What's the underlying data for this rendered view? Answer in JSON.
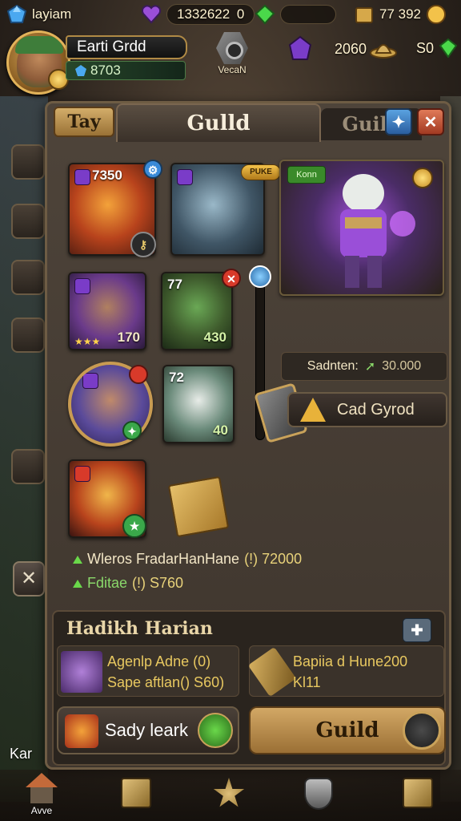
{
  "top_bar": {
    "player_tag": "layiam",
    "premium_currency": "1332622",
    "premium_secondary": "0",
    "gold": "77 392"
  },
  "player": {
    "name": "Earti Grdd",
    "power": "8703"
  },
  "vecan_label": "VecaN",
  "resources_row2": {
    "shards": "2060",
    "tokens": "S0"
  },
  "tabs": {
    "left": "Tay",
    "active": "Gulld",
    "inactive": "Guild"
  },
  "cards": {
    "card1_level": "7350",
    "card2_tag": "PUKE",
    "card3_tag": "Konn",
    "card4_stars": "★★★",
    "card4_value": "170",
    "card5_level": "77",
    "card5_value": "430",
    "card7_level": "72",
    "card7_value": "40"
  },
  "hero_panel": {
    "stat_label": "Sadnten:",
    "stat_value": "30.000",
    "action_label": "Cad Gyrod"
  },
  "info_lines": [
    {
      "label": "Wleros FradarHanHane",
      "value": "(!) 72000"
    },
    {
      "label": "Fditae",
      "value": "(!) S760"
    }
  ],
  "bottom_section": {
    "title": "Hadikh Harian",
    "item1_line1": "Agenlp Adne (0)",
    "item1_line2": "Sape aftlan() S60)",
    "item2_line1": "Bapiia d Hune200",
    "item2_line2": "Kl11",
    "btn_left": "Sady leark",
    "btn_right": "Guild"
  },
  "side_text": "Kar",
  "nav": {
    "home_label": "Avve"
  },
  "colors": {
    "panel_bg": "#4e443a",
    "gold_text": "#e8c860",
    "accent_green": "#6ad84a",
    "accent_purple": "#9a4fd8"
  }
}
